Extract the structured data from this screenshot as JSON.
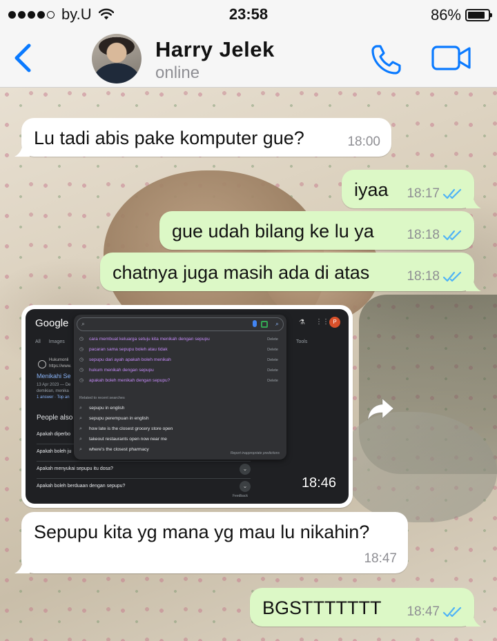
{
  "status_bar": {
    "carrier": "by.U",
    "time": "23:58",
    "battery_percent": "86%",
    "battery_level": 0.86,
    "signal_bars": 4
  },
  "header": {
    "contact_name": "Harry Jelek",
    "contact_status": "online",
    "back_icon": "chevron-left-icon",
    "call_icon": "phone-icon",
    "video_icon": "video-camera-icon",
    "accent_color": "#0a7aff"
  },
  "messages": [
    {
      "direction": "in",
      "text": "Lu tadi abis pake komputer gue?",
      "time": "18:00"
    },
    {
      "direction": "out",
      "text": "iyaa",
      "time": "18:17",
      "status": "read"
    },
    {
      "direction": "out",
      "text": "gue udah bilang ke lu ya",
      "time": "18:18",
      "status": "read"
    },
    {
      "direction": "out",
      "text": "chatnya juga masih ada di atas",
      "time": "18:18",
      "status": "read"
    },
    {
      "direction": "in",
      "type": "image",
      "time": "18:46"
    },
    {
      "direction": "in",
      "text": "Sepupu kita yg mana yg mau lu nikahin?",
      "time": "18:47"
    },
    {
      "direction": "out",
      "text": "BGSTTTTTTT",
      "time": "18:47",
      "status": "read"
    }
  ],
  "image_content": {
    "logo": "Google",
    "tabs": [
      "All",
      "Images"
    ],
    "tools": "Tools",
    "profile_initial": "P",
    "history_items": [
      "cara membuat keluarga setuju kita menikah dengan sepupu",
      "pacaran sama sepupu boleh atau tidak",
      "sepupu dari ayah apakah boleh menikah",
      "hukum menikah dengan sepupu",
      "apakah boleh menikah dengan sepupu?"
    ],
    "delete_label": "Delete",
    "related_heading": "Related to recent searches",
    "related_items": [
      "sepupu in english",
      "sepupu perempuan in english",
      "how late is the closest grocery store open",
      "takeout restaurants open now near me",
      "where's the closest pharmacy"
    ],
    "report_text": "Report inappropriate predictions",
    "result_site": "Hukumonli",
    "result_url": "https://www.",
    "result_title": "Menikahi Se",
    "result_snippet": "13 Apr 2023 — De demikian, menika",
    "result_answers": "1 answer · Top an",
    "people_also_ask": "People also",
    "paa_items": [
      "Apakah diperbo",
      "Apakah boleh ju",
      "Apakah menyukai sepupu itu dosa?",
      "Apakah boleh berduaan dengan sepupu?"
    ],
    "feedback": "Feedback"
  },
  "forward_icon": "forward-arrow-icon",
  "colors": {
    "incoming_bubble": "#ffffff",
    "outgoing_bubble": "#dcf8c6",
    "read_ticks": "#4fb3f6",
    "timestamp": "#8e8e93"
  }
}
